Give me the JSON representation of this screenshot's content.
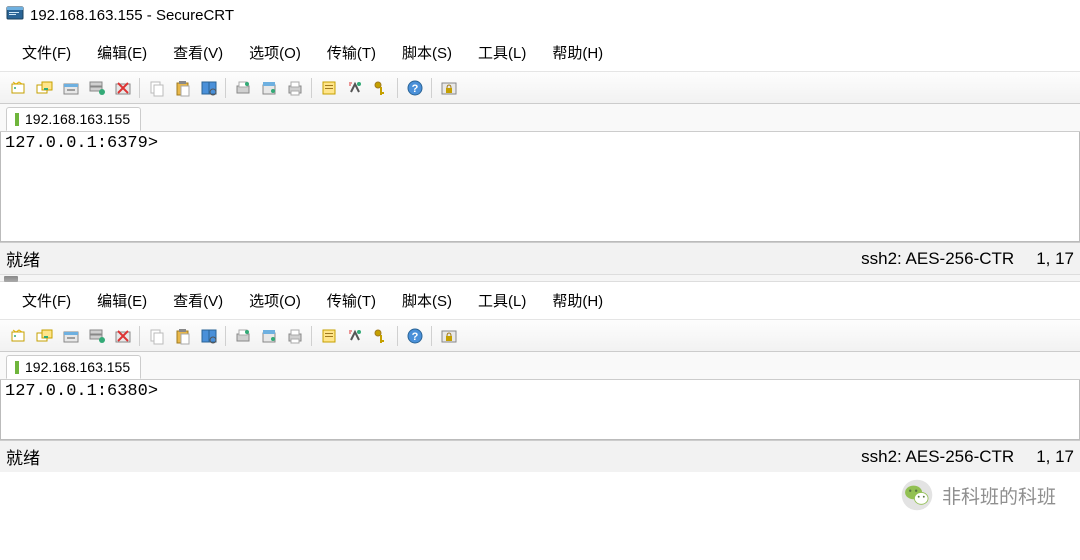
{
  "titlebar": {
    "title": "192.168.163.155 - SecureCRT"
  },
  "menu": {
    "file": "文件(F)",
    "edit": "编辑(E)",
    "view": "查看(V)",
    "options": "选项(O)",
    "transfer": "传输(T)",
    "script": "脚本(S)",
    "tools": "工具(L)",
    "help": "帮助(H)"
  },
  "tab": {
    "label": "192.168.163.155"
  },
  "pane1": {
    "prompt": "127.0.0.1:6379>",
    "status_left": "就绪",
    "status_cipher": "ssh2: AES-256-CTR",
    "status_pos": "1,  17"
  },
  "pane2": {
    "prompt": "127.0.0.1:6380>",
    "status_left": "就绪",
    "status_cipher": "ssh2: AES-256-CTR",
    "status_pos": "1,  17"
  },
  "overlay": {
    "wechat_text": "非科班的科班"
  }
}
